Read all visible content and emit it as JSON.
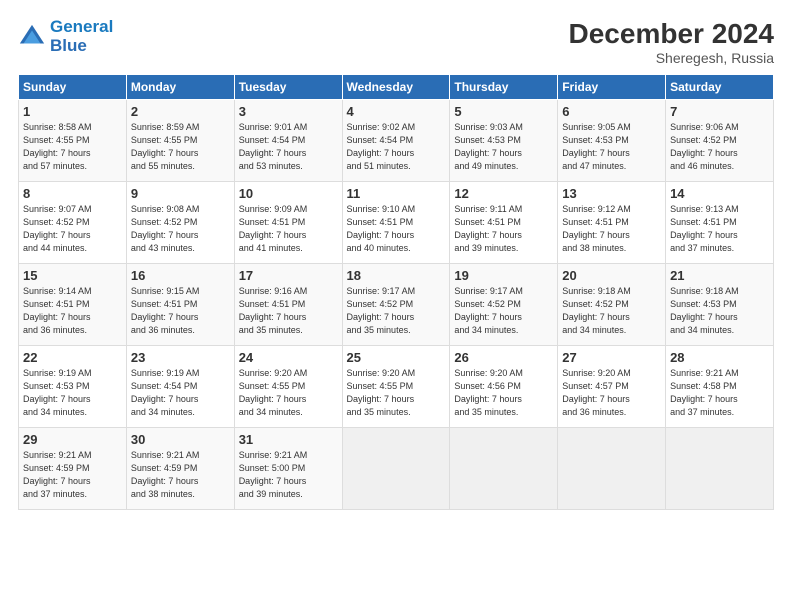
{
  "header": {
    "logo_line1": "General",
    "logo_line2": "Blue",
    "month": "December 2024",
    "location": "Sheregesh, Russia"
  },
  "weekdays": [
    "Sunday",
    "Monday",
    "Tuesday",
    "Wednesday",
    "Thursday",
    "Friday",
    "Saturday"
  ],
  "weeks": [
    [
      {
        "day": "1",
        "lines": [
          "Sunrise: 8:58 AM",
          "Sunset: 4:55 PM",
          "Daylight: 7 hours",
          "and 57 minutes."
        ]
      },
      {
        "day": "2",
        "lines": [
          "Sunrise: 8:59 AM",
          "Sunset: 4:55 PM",
          "Daylight: 7 hours",
          "and 55 minutes."
        ]
      },
      {
        "day": "3",
        "lines": [
          "Sunrise: 9:01 AM",
          "Sunset: 4:54 PM",
          "Daylight: 7 hours",
          "and 53 minutes."
        ]
      },
      {
        "day": "4",
        "lines": [
          "Sunrise: 9:02 AM",
          "Sunset: 4:54 PM",
          "Daylight: 7 hours",
          "and 51 minutes."
        ]
      },
      {
        "day": "5",
        "lines": [
          "Sunrise: 9:03 AM",
          "Sunset: 4:53 PM",
          "Daylight: 7 hours",
          "and 49 minutes."
        ]
      },
      {
        "day": "6",
        "lines": [
          "Sunrise: 9:05 AM",
          "Sunset: 4:53 PM",
          "Daylight: 7 hours",
          "and 47 minutes."
        ]
      },
      {
        "day": "7",
        "lines": [
          "Sunrise: 9:06 AM",
          "Sunset: 4:52 PM",
          "Daylight: 7 hours",
          "and 46 minutes."
        ]
      }
    ],
    [
      {
        "day": "8",
        "lines": [
          "Sunrise: 9:07 AM",
          "Sunset: 4:52 PM",
          "Daylight: 7 hours",
          "and 44 minutes."
        ]
      },
      {
        "day": "9",
        "lines": [
          "Sunrise: 9:08 AM",
          "Sunset: 4:52 PM",
          "Daylight: 7 hours",
          "and 43 minutes."
        ]
      },
      {
        "day": "10",
        "lines": [
          "Sunrise: 9:09 AM",
          "Sunset: 4:51 PM",
          "Daylight: 7 hours",
          "and 41 minutes."
        ]
      },
      {
        "day": "11",
        "lines": [
          "Sunrise: 9:10 AM",
          "Sunset: 4:51 PM",
          "Daylight: 7 hours",
          "and 40 minutes."
        ]
      },
      {
        "day": "12",
        "lines": [
          "Sunrise: 9:11 AM",
          "Sunset: 4:51 PM",
          "Daylight: 7 hours",
          "and 39 minutes."
        ]
      },
      {
        "day": "13",
        "lines": [
          "Sunrise: 9:12 AM",
          "Sunset: 4:51 PM",
          "Daylight: 7 hours",
          "and 38 minutes."
        ]
      },
      {
        "day": "14",
        "lines": [
          "Sunrise: 9:13 AM",
          "Sunset: 4:51 PM",
          "Daylight: 7 hours",
          "and 37 minutes."
        ]
      }
    ],
    [
      {
        "day": "15",
        "lines": [
          "Sunrise: 9:14 AM",
          "Sunset: 4:51 PM",
          "Daylight: 7 hours",
          "and 36 minutes."
        ]
      },
      {
        "day": "16",
        "lines": [
          "Sunrise: 9:15 AM",
          "Sunset: 4:51 PM",
          "Daylight: 7 hours",
          "and 36 minutes."
        ]
      },
      {
        "day": "17",
        "lines": [
          "Sunrise: 9:16 AM",
          "Sunset: 4:51 PM",
          "Daylight: 7 hours",
          "and 35 minutes."
        ]
      },
      {
        "day": "18",
        "lines": [
          "Sunrise: 9:17 AM",
          "Sunset: 4:52 PM",
          "Daylight: 7 hours",
          "and 35 minutes."
        ]
      },
      {
        "day": "19",
        "lines": [
          "Sunrise: 9:17 AM",
          "Sunset: 4:52 PM",
          "Daylight: 7 hours",
          "and 34 minutes."
        ]
      },
      {
        "day": "20",
        "lines": [
          "Sunrise: 9:18 AM",
          "Sunset: 4:52 PM",
          "Daylight: 7 hours",
          "and 34 minutes."
        ]
      },
      {
        "day": "21",
        "lines": [
          "Sunrise: 9:18 AM",
          "Sunset: 4:53 PM",
          "Daylight: 7 hours",
          "and 34 minutes."
        ]
      }
    ],
    [
      {
        "day": "22",
        "lines": [
          "Sunrise: 9:19 AM",
          "Sunset: 4:53 PM",
          "Daylight: 7 hours",
          "and 34 minutes."
        ]
      },
      {
        "day": "23",
        "lines": [
          "Sunrise: 9:19 AM",
          "Sunset: 4:54 PM",
          "Daylight: 7 hours",
          "and 34 minutes."
        ]
      },
      {
        "day": "24",
        "lines": [
          "Sunrise: 9:20 AM",
          "Sunset: 4:55 PM",
          "Daylight: 7 hours",
          "and 34 minutes."
        ]
      },
      {
        "day": "25",
        "lines": [
          "Sunrise: 9:20 AM",
          "Sunset: 4:55 PM",
          "Daylight: 7 hours",
          "and 35 minutes."
        ]
      },
      {
        "day": "26",
        "lines": [
          "Sunrise: 9:20 AM",
          "Sunset: 4:56 PM",
          "Daylight: 7 hours",
          "and 35 minutes."
        ]
      },
      {
        "day": "27",
        "lines": [
          "Sunrise: 9:20 AM",
          "Sunset: 4:57 PM",
          "Daylight: 7 hours",
          "and 36 minutes."
        ]
      },
      {
        "day": "28",
        "lines": [
          "Sunrise: 9:21 AM",
          "Sunset: 4:58 PM",
          "Daylight: 7 hours",
          "and 37 minutes."
        ]
      }
    ],
    [
      {
        "day": "29",
        "lines": [
          "Sunrise: 9:21 AM",
          "Sunset: 4:59 PM",
          "Daylight: 7 hours",
          "and 37 minutes."
        ]
      },
      {
        "day": "30",
        "lines": [
          "Sunrise: 9:21 AM",
          "Sunset: 4:59 PM",
          "Daylight: 7 hours",
          "and 38 minutes."
        ]
      },
      {
        "day": "31",
        "lines": [
          "Sunrise: 9:21 AM",
          "Sunset: 5:00 PM",
          "Daylight: 7 hours",
          "and 39 minutes."
        ]
      },
      null,
      null,
      null,
      null
    ]
  ]
}
